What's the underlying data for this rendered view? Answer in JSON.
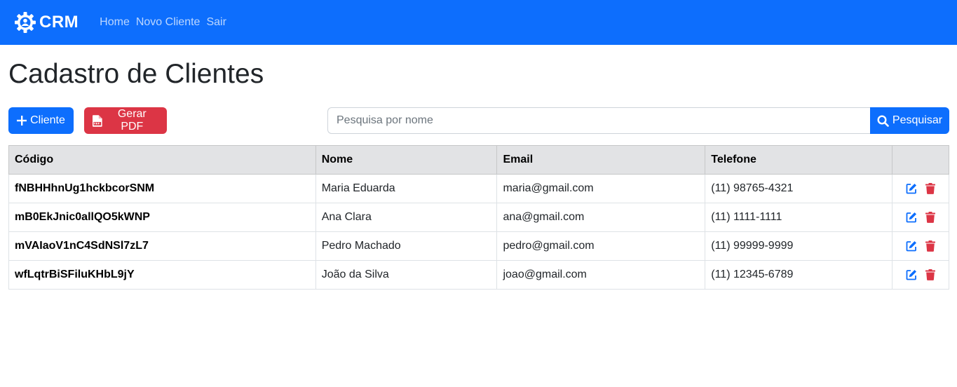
{
  "navbar": {
    "brand": "CRM",
    "links": [
      "Home",
      "Novo Cliente",
      "Sair"
    ],
    "bg_color": "#0d6efd"
  },
  "page": {
    "title": "Cadastro de Clientes"
  },
  "toolbar": {
    "add_label": "Cliente",
    "pdf_label": "Gerar PDF",
    "search_placeholder": "Pesquisa por nome",
    "search_label": "Pesquisar"
  },
  "table": {
    "headers": [
      "Código",
      "Nome",
      "Email",
      "Telefone",
      ""
    ],
    "rows": [
      {
        "code": "fNBHHhnUg1hckbcorSNM",
        "name": "Maria Eduarda",
        "email": "maria@gmail.com",
        "phone": "(11) 98765-4321"
      },
      {
        "code": "mB0EkJnic0allQO5kWNP",
        "name": "Ana Clara",
        "email": "ana@gmail.com",
        "phone": "(11) 1111-1111"
      },
      {
        "code": "mVAIaoV1nC4SdNSl7zL7",
        "name": "Pedro Machado",
        "email": "pedro@gmail.com",
        "phone": "(11) 99999-9999"
      },
      {
        "code": "wfLqtrBiSFiluKHbL9jY",
        "name": "João da Silva",
        "email": "joao@gmail.com",
        "phone": "(11) 12345-6789"
      }
    ]
  },
  "colors": {
    "primary": "#0d6efd",
    "danger": "#dc3545",
    "header_bg": "#e2e3e5"
  },
  "icons": {
    "brand": "gear-user-icon",
    "add": "plus-icon",
    "pdf": "file-pdf-icon",
    "search": "search-icon",
    "edit": "edit-icon",
    "delete": "trash-icon"
  }
}
